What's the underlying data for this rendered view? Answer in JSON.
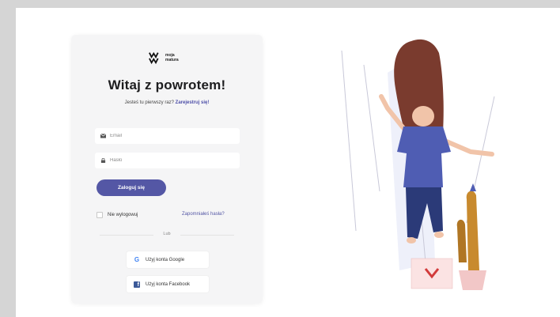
{
  "logo": {
    "line1": "moja",
    "line2": "matura"
  },
  "login": {
    "title": "Witaj z powrotem!",
    "subtitle_text": "Jesteś tu pierwszy raz?",
    "register_link": "Zarejestruj się!",
    "email_placeholder": "Email",
    "password_placeholder": "Hasło",
    "submit_label": "Zaloguj się",
    "remember_label": "Nie wylogowuj",
    "forgot_label": "Zapomniałeś hasła?",
    "divider_label": "Lub",
    "google_label": "Użyj konta Google",
    "facebook_label": "Użyj konta Facebook"
  },
  "icons": {
    "email": "envelope-icon",
    "password": "lock-icon",
    "google": "google-icon",
    "facebook": "facebook-icon"
  },
  "colors": {
    "accent": "#5457a5",
    "card_bg": "#f5f5f6",
    "frame_bg": "#d5d5d5"
  }
}
